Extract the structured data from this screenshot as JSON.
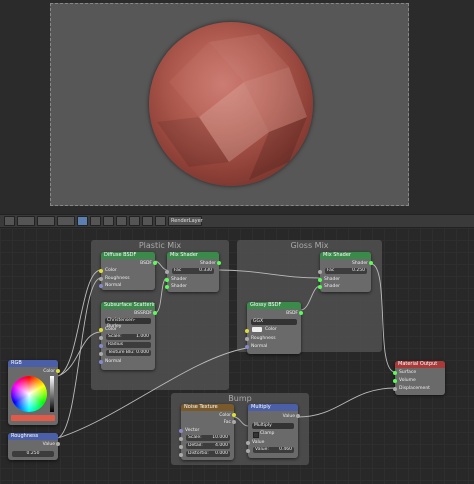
{
  "header": {
    "layer_field": "RenderLayer"
  },
  "frames": {
    "plastic": "Plastic Mix",
    "gloss": "Gloss Mix",
    "bump": "Bump"
  },
  "diffuse": {
    "title": "Diffuse BSDF",
    "out": "BSDF",
    "in_color": "Color",
    "in_rough": "Roughness",
    "in_normal": "Normal"
  },
  "mix1": {
    "title": "Mix Shader",
    "out": "Shader",
    "fac_label": "Fac",
    "fac_value": "0.330",
    "in1": "Shader",
    "in2": "Shader"
  },
  "sss": {
    "title": "Subsurface Scattering",
    "out": "BSSRDF",
    "mode": "Christensen-Burley",
    "in_color": "Color",
    "scale": "Scale:",
    "scale_val": "1.000",
    "radius": "Radius",
    "tex_blur": "Texture Blu:",
    "tex_blur_val": "0.000",
    "in_normal": "Normal"
  },
  "mix2": {
    "title": "Mix Shader",
    "out": "Shader",
    "fac_label": "Fac",
    "fac_value": "0.250",
    "in1": "Shader",
    "in2": "Shader"
  },
  "glossy": {
    "title": "Glossy BSDF",
    "out": "BSDF",
    "dist": "GGX",
    "in_color": "Color",
    "in_rough": "Roughness",
    "in_normal": "Normal"
  },
  "output": {
    "title": "Material Output",
    "surface": "Surface",
    "volume": "Volume",
    "displacement": "Displacement"
  },
  "rgb": {
    "title": "RGB",
    "out": "Color",
    "swatch": "#e05a4a"
  },
  "roughness": {
    "title": "Roughness",
    "out": "Value",
    "value": "0.250"
  },
  "noise": {
    "title": "Noise Texture",
    "out_color": "Color",
    "out_fac": "Fac",
    "in_vector": "Vector",
    "scale": "Scale:",
    "scale_val": "10.000",
    "detail": "Detail:",
    "detail_val": "4.000",
    "distortion": "Distortio:",
    "distortion_val": "0.000"
  },
  "multiply": {
    "title": "Multiply",
    "out": "Value",
    "op": "Multiply",
    "clamp": "Clamp",
    "in_value": "Value",
    "value_label": "Value:",
    "value_val": "0.460"
  }
}
